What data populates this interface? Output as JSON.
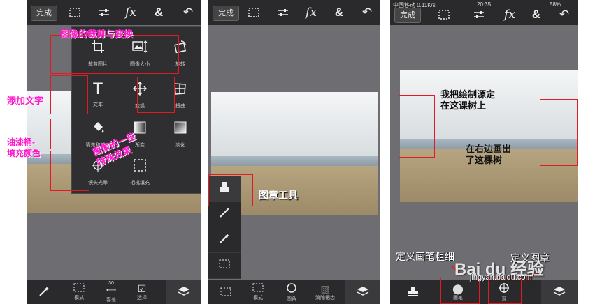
{
  "topbar": {
    "done_label": "完成",
    "icons": [
      "selection-icon",
      "adjust-icon",
      "fx-icon",
      "ampersand-icon",
      "undo-icon"
    ],
    "fx_label": "fx",
    "amp_label": "&"
  },
  "panel3_status": {
    "left": "中国移动 0.11K/s",
    "time": "20:35",
    "battery": "58%"
  },
  "menu": {
    "items": [
      {
        "label": "裁剪图片",
        "icon": "crop-icon"
      },
      {
        "label": "图像大小",
        "icon": "image-size-icon"
      },
      {
        "label": "旋转",
        "icon": "rotate-icon"
      },
      {
        "label": "文本",
        "icon": "text-icon"
      },
      {
        "label": "变换",
        "icon": "transform-icon"
      },
      {
        "label": "扭曲",
        "icon": "distort-icon"
      },
      {
        "label": "填充和描边",
        "icon": "fill-bucket-icon"
      },
      {
        "label": "渐变",
        "icon": "gradient-icon"
      },
      {
        "label": "淡化",
        "icon": "fade-icon"
      },
      {
        "label": "镜头光晕",
        "icon": "lens-flare-icon"
      },
      {
        "label": "相机填充",
        "icon": "camera-fill-icon"
      }
    ]
  },
  "annotations": {
    "crop_resize_rotate": "图像的裁剪与变换",
    "add_text": "添加文字",
    "paint_bucket": "油漆桶-\n填充颜色",
    "image_effects": "图像的一些\n特殊效果",
    "stamp_tool": "图章工具",
    "source_tree": "我把绘制源定\n在这课树上",
    "right_tree": "在右边画出\n了这棵树",
    "brush_size": "定义画笔粗细",
    "define_stamp": "定义图章",
    "watermark": "Bai du 经验",
    "watermark_url": "jingyan.baidu.com"
  },
  "panel1_bottom": {
    "items": [
      {
        "label": "",
        "icon": "magic-wand-icon"
      },
      {
        "label": "模式",
        "icon": "marquee-icon"
      },
      {
        "label": "容差",
        "value": "30",
        "icon": "tolerance-slider-icon"
      },
      {
        "label": "选择",
        "icon": "checkbox-icon"
      },
      {
        "label": "",
        "icon": "layers-icon"
      }
    ]
  },
  "panel2_bottom": {
    "items": [
      {
        "label": "",
        "icon": "marquee-icon"
      },
      {
        "label": "模式",
        "icon": "marquee-icon"
      },
      {
        "label": "圆角",
        "icon": "rounded-corner-icon"
      },
      {
        "label": "消除锯齿",
        "icon": "antialias-icon"
      },
      {
        "label": "",
        "icon": "layers-icon"
      }
    ]
  },
  "panel2_tools": [
    "stamp-icon",
    "brush-icon",
    "magic-wand-icon",
    "marquee-icon"
  ],
  "panel3_bottom": {
    "items": [
      {
        "label": "",
        "icon": "stamp-icon"
      },
      {
        "label": "画笔",
        "icon": "brush-size-icon"
      },
      {
        "label": "源",
        "icon": "target-icon"
      },
      {
        "label": "",
        "icon": "layers-icon"
      }
    ]
  }
}
